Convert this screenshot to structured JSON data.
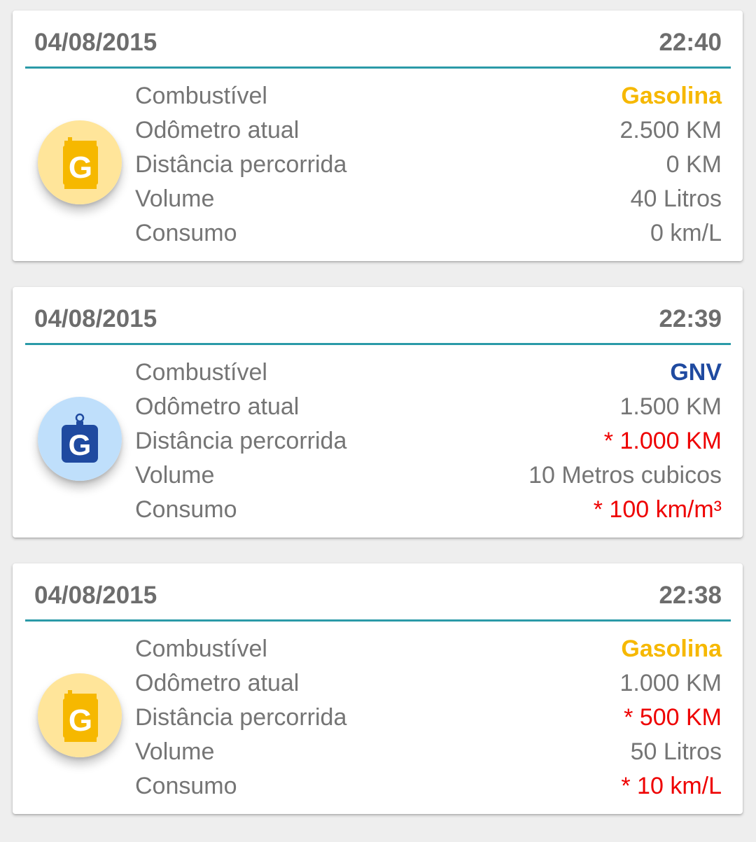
{
  "labels": {
    "fuel": "Combustível",
    "odometer": "Odômetro atual",
    "distance": "Distância percorrida",
    "volume": "Volume",
    "consumption": "Consumo"
  },
  "colors": {
    "gasolina": "#f6b800",
    "gnv": "#1f4aa0",
    "alert": "#ee0000",
    "text": "#757575",
    "divider": "#2b9aa8"
  },
  "entries": [
    {
      "date": "04/08/2015",
      "time": "22:40",
      "fuel": "Gasolina",
      "fuel_icon": "gasoline-can-icon",
      "odometer": "2.500 KM",
      "distance": "0 KM",
      "volume": "40 Litros",
      "consumption": "0 km/L"
    },
    {
      "date": "04/08/2015",
      "time": "22:39",
      "fuel": "GNV",
      "fuel_icon": "gas-cylinder-icon",
      "odometer": "1.500 KM",
      "distance": "* 1.000 KM",
      "volume": "10 Metros cubicos",
      "consumption": "* 100 km/m³"
    },
    {
      "date": "04/08/2015",
      "time": "22:38",
      "fuel": "Gasolina",
      "fuel_icon": "gasoline-can-icon",
      "odometer": "1.000 KM",
      "distance": "* 500 KM",
      "volume": "50 Litros",
      "consumption": "* 10 km/L"
    }
  ]
}
